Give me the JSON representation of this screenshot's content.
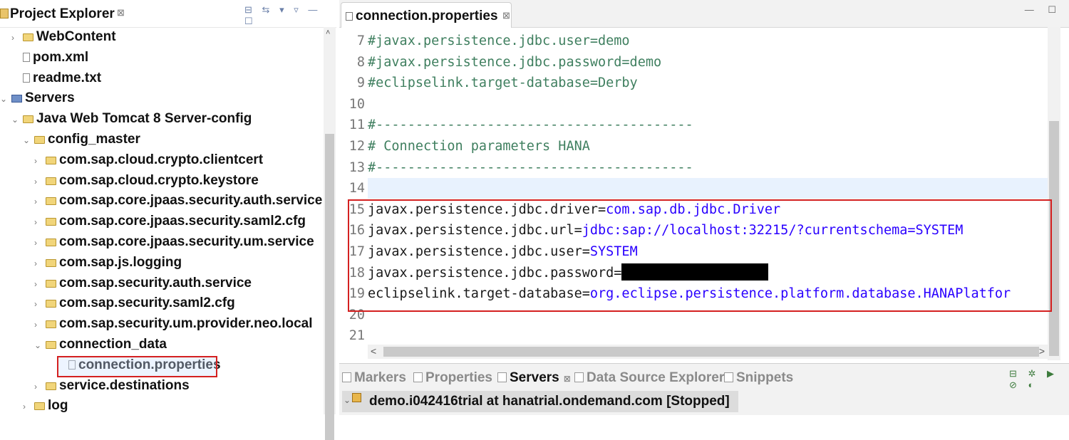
{
  "project_explorer": {
    "title": "Project Explorer",
    "close": "⊠",
    "toolbar": [
      "⊟",
      "⇆",
      "▾",
      "▿",
      "—",
      "☐"
    ],
    "tree": [
      {
        "label": "WebContent",
        "twisty": "›",
        "icon": "folder-icon",
        "level": 1
      },
      {
        "label": "pom.xml",
        "twisty": "",
        "icon": "file-icon",
        "level": 1
      },
      {
        "label": "readme.txt",
        "twisty": "",
        "icon": "file-icon",
        "level": 1
      },
      {
        "label": "Servers",
        "twisty": "⌄",
        "icon": "servers-folder-icon",
        "level": 0
      },
      {
        "label": "Java Web Tomcat 8 Server-config",
        "twisty": "⌄",
        "icon": "folder-icon",
        "level": 1
      },
      {
        "label": "config_master",
        "twisty": "⌄",
        "icon": "folder-icon",
        "level": 2
      },
      {
        "label": "com.sap.cloud.crypto.clientcert",
        "twisty": "›",
        "icon": "folder-icon",
        "level": 3
      },
      {
        "label": "com.sap.cloud.crypto.keystore",
        "twisty": "›",
        "icon": "folder-icon",
        "level": 3
      },
      {
        "label": "com.sap.core.jpaas.security.auth.service",
        "twisty": "›",
        "icon": "folder-icon",
        "level": 3
      },
      {
        "label": "com.sap.core.jpaas.security.saml2.cfg",
        "twisty": "›",
        "icon": "folder-icon",
        "level": 3
      },
      {
        "label": "com.sap.core.jpaas.security.um.service",
        "twisty": "›",
        "icon": "folder-icon",
        "level": 3
      },
      {
        "label": "com.sap.js.logging",
        "twisty": "›",
        "icon": "folder-icon",
        "level": 3
      },
      {
        "label": "com.sap.security.auth.service",
        "twisty": "›",
        "icon": "folder-icon",
        "level": 3
      },
      {
        "label": "com.sap.security.saml2.cfg",
        "twisty": "›",
        "icon": "folder-icon",
        "level": 3
      },
      {
        "label": "com.sap.security.um.provider.neo.local",
        "twisty": "›",
        "icon": "folder-icon",
        "level": 3
      },
      {
        "label": "connection_data",
        "twisty": "⌄",
        "icon": "folder-icon",
        "level": 3
      },
      {
        "label": "connection.properties",
        "twisty": "",
        "icon": "file-icon",
        "level": 4,
        "selected": true
      },
      {
        "label": "service.destinations",
        "twisty": "›",
        "icon": "folder-icon",
        "level": 3
      },
      {
        "label": "log",
        "twisty": "›",
        "icon": "folder-icon",
        "level": 2
      }
    ]
  },
  "editor": {
    "tab_label": "connection.properties",
    "tab_close": "⊠",
    "minmax": "— ☐",
    "lines": [
      {
        "n": "7",
        "parts": [
          {
            "t": "#javax.persistence.jdbc.user=demo",
            "c": "cm"
          }
        ]
      },
      {
        "n": "8",
        "parts": [
          {
            "t": "#javax.persistence.jdbc.password=demo",
            "c": "cm"
          }
        ]
      },
      {
        "n": "9",
        "parts": [
          {
            "t": "#eclipselink.target-database=Derby",
            "c": "cm"
          }
        ]
      },
      {
        "n": "10",
        "parts": []
      },
      {
        "n": "11",
        "parts": [
          {
            "t": "#----------------------------------------",
            "c": "cm"
          }
        ]
      },
      {
        "n": "12",
        "parts": [
          {
            "t": "# Connection parameters HANA",
            "c": "cm"
          }
        ]
      },
      {
        "n": "13",
        "parts": [
          {
            "t": "#----------------------------------------",
            "c": "cm"
          }
        ]
      },
      {
        "n": "14",
        "parts": []
      },
      {
        "n": "15",
        "parts": [
          {
            "t": "javax.persistence.jdbc.driver=",
            "c": "k"
          },
          {
            "t": "com.sap.db.jdbc.Driver",
            "c": "v"
          }
        ]
      },
      {
        "n": "16",
        "parts": [
          {
            "t": "javax.persistence.jdbc.url=",
            "c": "k"
          },
          {
            "t": "jdbc:sap://localhost:32215/?currentschema=SYSTEM",
            "c": "v"
          }
        ]
      },
      {
        "n": "17",
        "parts": [
          {
            "t": "javax.persistence.jdbc.user=",
            "c": "k"
          },
          {
            "t": "SYSTEM",
            "c": "v"
          }
        ]
      },
      {
        "n": "18",
        "parts": [
          {
            "t": "javax.persistence.jdbc.password=",
            "c": "k"
          },
          {
            "t": "",
            "c": "redact"
          }
        ]
      },
      {
        "n": "19",
        "parts": [
          {
            "t": "eclipselink.target-database=",
            "c": "k"
          },
          {
            "t": "org.eclipse.persistence.platform.database.HANAPlatfor",
            "c": "v"
          }
        ]
      },
      {
        "n": "20",
        "parts": []
      },
      {
        "n": "21",
        "parts": []
      }
    ],
    "scroll_left": "<",
    "scroll_right": ">"
  },
  "bottom_panel": {
    "tabs": [
      {
        "label": "Markers",
        "active": false,
        "icon": "markers-icon"
      },
      {
        "label": "Properties",
        "active": false,
        "icon": "properties-icon"
      },
      {
        "label": "Servers",
        "active": true,
        "icon": "servers-icon",
        "close": "⊠"
      },
      {
        "label": "Data Source Explorer",
        "active": false,
        "icon": "datasource-icon"
      },
      {
        "label": "Snippets",
        "active": false,
        "icon": "snippets-icon"
      }
    ],
    "toolbar": "⊟ ✲ ▶ ⊘ ◐",
    "server_row": "demo.i042416trial at hanatrial.ondemand.com  [Stopped]"
  },
  "colors": {
    "highlight_border": "#d42020",
    "comment": "#3f7f5f",
    "value": "#2a00ff"
  }
}
